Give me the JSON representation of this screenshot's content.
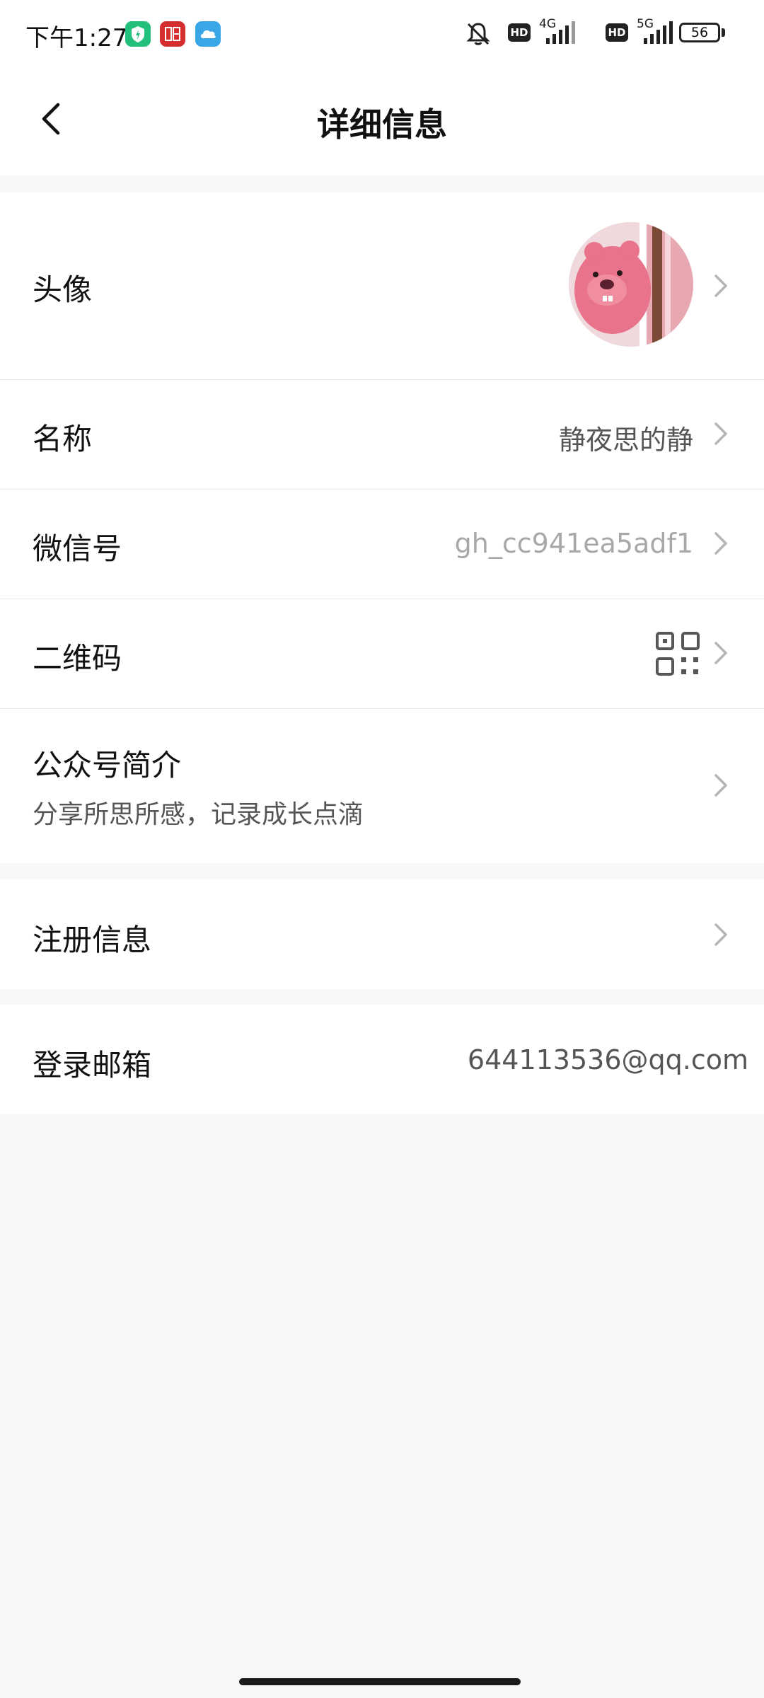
{
  "status_bar": {
    "time": "下午1:27",
    "network_1": "4G",
    "network_2": "5G",
    "hd_1": "HD",
    "hd_2": "HD",
    "battery": "56"
  },
  "nav": {
    "title": "详细信息"
  },
  "rows": {
    "avatar_label": "头像",
    "name_label": "名称",
    "name_value": "静夜思的静",
    "wechat_id_label": "微信号",
    "wechat_id_value": "gh_cc941ea5adf1",
    "qr_label": "二维码",
    "intro_label": "公众号简介",
    "intro_value": "分享所思所感，记录成长点滴",
    "register_label": "注册信息",
    "email_label": "登录邮箱",
    "email_value": "644113536@qq.com"
  },
  "colors": {
    "background": "#f6f7f7",
    "card": "#ffffff",
    "text_primary": "#111111",
    "text_secondary": "#555555",
    "chevron": "#b5b5b5"
  }
}
